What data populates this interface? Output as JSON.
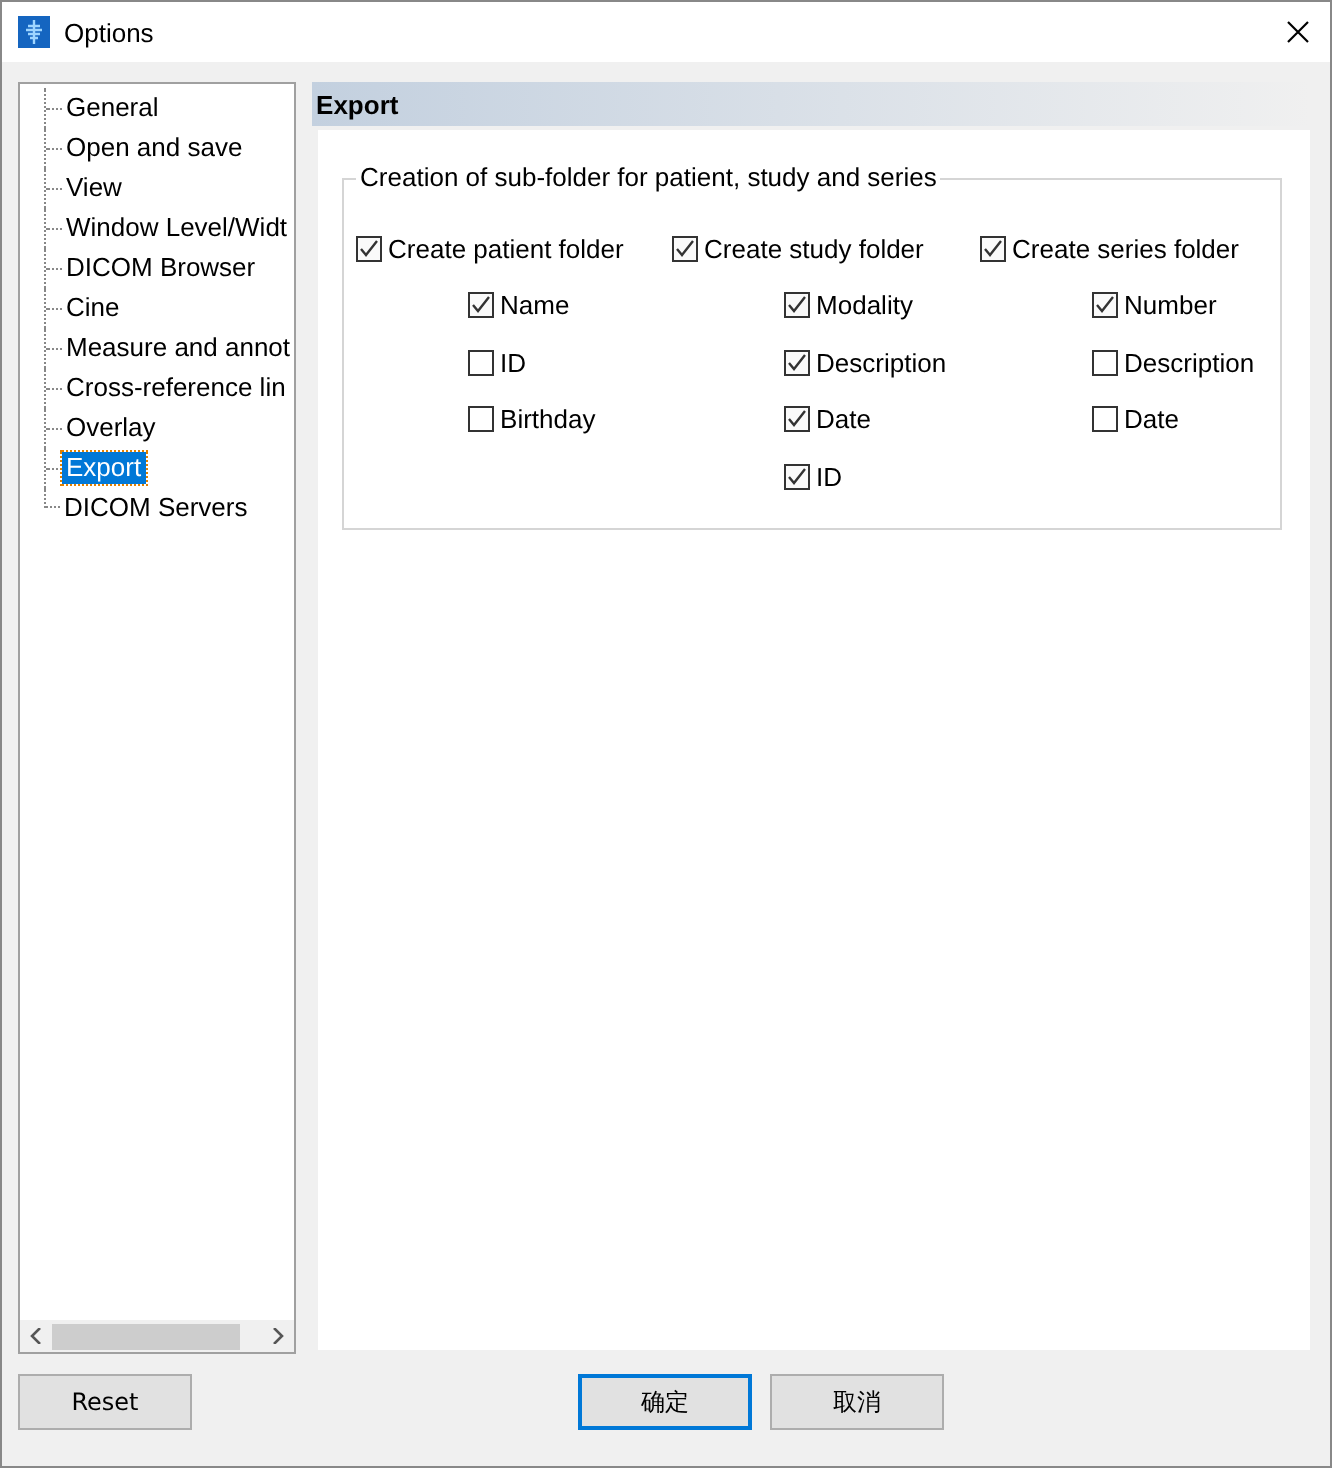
{
  "window": {
    "title": "Options"
  },
  "sidebar": {
    "items": [
      {
        "label": "General",
        "selected": false
      },
      {
        "label": "Open and save",
        "selected": false
      },
      {
        "label": "View",
        "selected": false
      },
      {
        "label": "Window Level/Widt",
        "selected": false
      },
      {
        "label": "DICOM Browser",
        "selected": false
      },
      {
        "label": "Cine",
        "selected": false
      },
      {
        "label": "Measure and annot",
        "selected": false
      },
      {
        "label": "Cross-reference lin",
        "selected": false
      },
      {
        "label": "Overlay",
        "selected": false
      },
      {
        "label": "Export",
        "selected": true
      },
      {
        "label": "DICOM Servers",
        "selected": false
      }
    ]
  },
  "panel": {
    "title": "Export",
    "group": {
      "legend": "Creation of sub-folder for patient, study and series",
      "columns": [
        {
          "label": "Create patient folder",
          "checked": true,
          "options": [
            {
              "label": "Name",
              "checked": true
            },
            {
              "label": "ID",
              "checked": false
            },
            {
              "label": "Birthday",
              "checked": false
            }
          ]
        },
        {
          "label": "Create study folder",
          "checked": true,
          "options": [
            {
              "label": "Modality",
              "checked": true
            },
            {
              "label": "Description",
              "checked": true
            },
            {
              "label": "Date",
              "checked": true
            },
            {
              "label": "ID",
              "checked": true
            }
          ]
        },
        {
          "label": "Create series folder",
          "checked": true,
          "options": [
            {
              "label": "Number",
              "checked": true
            },
            {
              "label": "Description",
              "checked": false
            },
            {
              "label": "Date",
              "checked": false
            }
          ]
        }
      ]
    }
  },
  "buttons": [
    {
      "label": "Reset",
      "kind": "left",
      "default": false
    },
    {
      "label": "确定",
      "kind": "right",
      "default": true
    },
    {
      "label": "取消",
      "kind": "right",
      "default": false
    }
  ]
}
